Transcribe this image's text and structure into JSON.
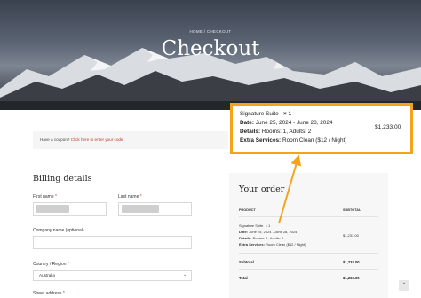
{
  "hero": {
    "breadcrumb": "HOME / CHECKOUT",
    "title": "Checkout"
  },
  "coupon": {
    "prompt": "Have a coupon?",
    "link": "Click here to enter your code"
  },
  "billing": {
    "title": "Billing details",
    "first_name_label": "First name",
    "last_name_label": "Last name",
    "company_label": "Company name (optional)",
    "country_label": "Country / Region",
    "country_value": "Australia",
    "street_label": "Street address",
    "required_mark": "*"
  },
  "order": {
    "title": "Your order",
    "col_product": "PRODUCT",
    "col_subtotal": "SUBTOTAL",
    "item_name": "Signature Suite",
    "item_qty": "× 1",
    "date_label": "Date:",
    "date_value": "June 25, 2024 - June 28, 2024",
    "details_label": "Details:",
    "details_value": "Rooms: 1, Adults: 2",
    "extra_label": "Extra Services:",
    "extra_value": "Room Clean ($12 / Night)",
    "item_price": "$1,233.00",
    "subtotal_label": "Subtotal",
    "subtotal_value": "$1,233.00",
    "total_label": "Total",
    "total_value": "$1,233.00"
  },
  "callout": {
    "item_name": "Signature Suite",
    "item_qty": "× 1",
    "date_label": "Date:",
    "date_value": "June 25, 2024 - June 28, 2024",
    "details_label": "Details:",
    "details_value": "Rooms: 1, Adults: 2",
    "extra_label": "Extra Services:",
    "extra_value": "Room Clean ($12 / Night)",
    "price": "$1,233.00"
  },
  "scroll_top_icon": "chevron-up-icon",
  "colors": {
    "highlight": "#f5a31a",
    "required": "#c0392b",
    "panel": "#f7f7f7"
  }
}
